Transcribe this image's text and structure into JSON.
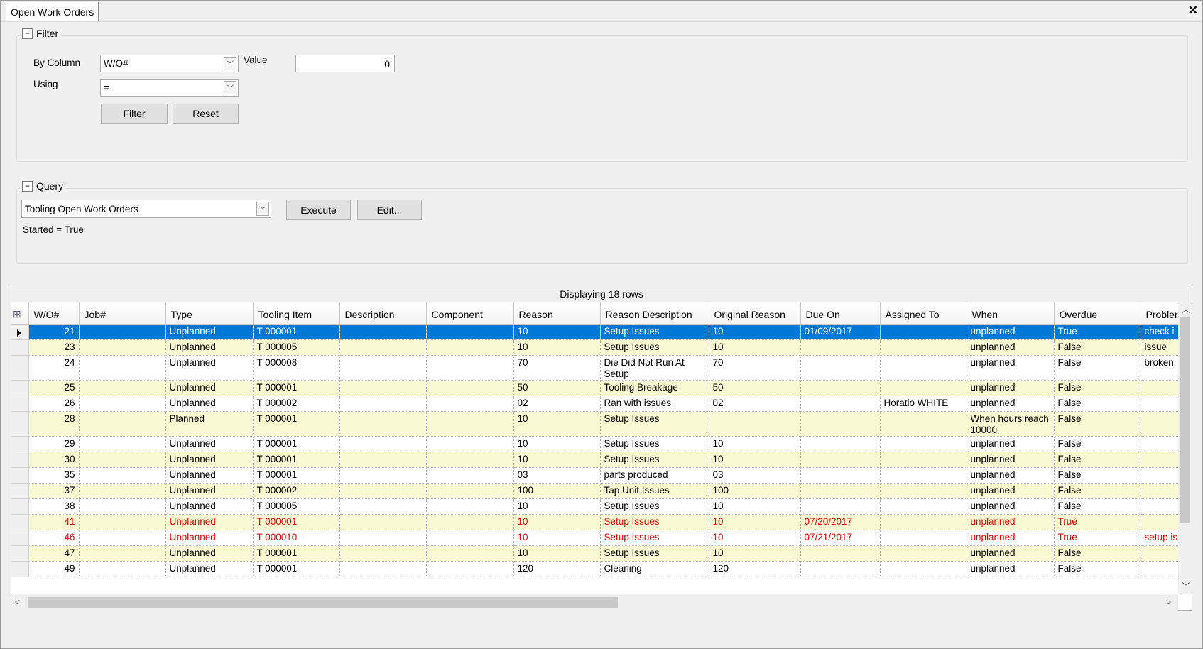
{
  "window": {
    "tab_title": "Open Work Orders",
    "close_icon": "close-icon"
  },
  "filter": {
    "title": "Filter",
    "by_column_label": "By Column",
    "by_column_value": "W/O#",
    "using_label": "Using",
    "using_value": "=",
    "value_label": "Value",
    "value": "0",
    "filter_button": "Filter",
    "reset_button": "Reset"
  },
  "query": {
    "title": "Query",
    "selected_query": "Tooling Open Work Orders",
    "execute_button": "Execute",
    "edit_button": "Edit...",
    "condition": "Started = True"
  },
  "grid": {
    "status": "Displaying 18 rows",
    "columns": [
      "W/O#",
      "Job#",
      "Type",
      "Tooling Item",
      "Description",
      "Component",
      "Reason",
      "Reason Description",
      "Original Reason",
      "Due On",
      "Assigned To",
      "When",
      "Overdue",
      "Probler"
    ],
    "colors": {
      "selected": "#0078d7",
      "alternate": "#fafad2",
      "overdue": "#ff0000"
    },
    "rows": [
      {
        "cells": [
          "21",
          "",
          "Unplanned",
          "T 000001",
          "",
          "",
          "10",
          "Setup Issues",
          "10",
          "01/09/2017",
          "",
          "unplanned",
          "True",
          "check i"
        ],
        "selected": true,
        "overdue": false
      },
      {
        "cells": [
          "23",
          "",
          "Unplanned",
          "T 000005",
          "",
          "",
          "10",
          "Setup Issues",
          "10",
          "",
          "",
          "unplanned",
          "False",
          "issue"
        ],
        "selected": false,
        "overdue": false
      },
      {
        "cells": [
          "24",
          "",
          "Unplanned",
          "T 000008",
          "",
          "",
          "70",
          "Die Did Not Run At Setup",
          "70",
          "",
          "",
          "unplanned",
          "False",
          "broken"
        ],
        "selected": false,
        "overdue": false,
        "tall": true
      },
      {
        "cells": [
          "25",
          "",
          "Unplanned",
          "T 000001",
          "",
          "",
          "50",
          "Tooling Breakage",
          "50",
          "",
          "",
          "unplanned",
          "False",
          ""
        ],
        "selected": false,
        "overdue": false
      },
      {
        "cells": [
          "26",
          "",
          "Unplanned",
          "T 000002",
          "",
          "",
          "02",
          "Ran with issues",
          "02",
          "",
          "Horatio WHITE",
          "unplanned",
          "False",
          ""
        ],
        "selected": false,
        "overdue": false
      },
      {
        "cells": [
          "28",
          "",
          "Planned",
          "T 000001",
          "",
          "",
          "10",
          "Setup Issues",
          "",
          "",
          "",
          "When hours reach 10000",
          "False",
          ""
        ],
        "selected": false,
        "overdue": false,
        "tall": true
      },
      {
        "cells": [
          "29",
          "",
          "Unplanned",
          "T 000001",
          "",
          "",
          "10",
          "Setup Issues",
          "10",
          "",
          "",
          "unplanned",
          "False",
          ""
        ],
        "selected": false,
        "overdue": false
      },
      {
        "cells": [
          "30",
          "",
          "Unplanned",
          "T 000001",
          "",
          "",
          "10",
          "Setup Issues",
          "10",
          "",
          "",
          "unplanned",
          "False",
          ""
        ],
        "selected": false,
        "overdue": false
      },
      {
        "cells": [
          "35",
          "",
          "Unplanned",
          "T 000001",
          "",
          "",
          "03",
          "parts produced",
          "03",
          "",
          "",
          "unplanned",
          "False",
          ""
        ],
        "selected": false,
        "overdue": false
      },
      {
        "cells": [
          "37",
          "",
          "Unplanned",
          "T 000002",
          "",
          "",
          "100",
          "Tap Unit Issues",
          "100",
          "",
          "",
          "unplanned",
          "False",
          ""
        ],
        "selected": false,
        "overdue": false
      },
      {
        "cells": [
          "38",
          "",
          "Unplanned",
          "T 000005",
          "",
          "",
          "10",
          "Setup Issues",
          "10",
          "",
          "",
          "unplanned",
          "False",
          ""
        ],
        "selected": false,
        "overdue": false
      },
      {
        "cells": [
          "41",
          "",
          "Unplanned",
          "T 000001",
          "",
          "",
          "10",
          "Setup Issues",
          "10",
          "07/20/2017",
          "",
          "unplanned",
          "True",
          ""
        ],
        "selected": false,
        "overdue": true
      },
      {
        "cells": [
          "46",
          "",
          "Unplanned",
          "T 000010",
          "",
          "",
          "10",
          "Setup Issues",
          "10",
          "07/21/2017",
          "",
          "unplanned",
          "True",
          "setup is"
        ],
        "selected": false,
        "overdue": true
      },
      {
        "cells": [
          "47",
          "",
          "Unplanned",
          "T 000001",
          "",
          "",
          "10",
          "Setup Issues",
          "10",
          "",
          "",
          "unplanned",
          "False",
          ""
        ],
        "selected": false,
        "overdue": false
      },
      {
        "cells": [
          "49",
          "",
          "Unplanned",
          "T 000001",
          "",
          "",
          "120",
          "Cleaning",
          "120",
          "",
          "",
          "unplanned",
          "False",
          ""
        ],
        "selected": false,
        "overdue": false
      }
    ]
  }
}
